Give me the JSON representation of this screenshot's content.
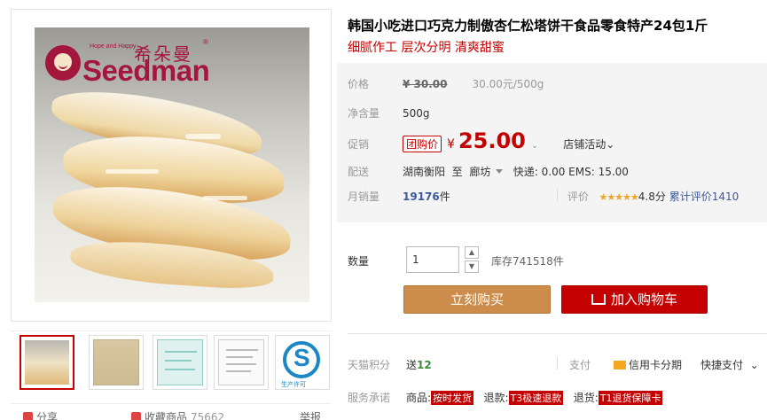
{
  "gallery": {
    "logo": {
      "brand_cn": "希朵曼",
      "brand_en": "Seedman",
      "tagline": "Hope and Happy",
      "reg": "®"
    },
    "thumbs": [
      {
        "name": "thumb-pastry",
        "active": true
      },
      {
        "name": "thumb-package"
      },
      {
        "name": "thumb-certificate"
      },
      {
        "name": "thumb-document"
      },
      {
        "name": "thumb-qs",
        "caption": "生产许可"
      }
    ],
    "share_label": "分享",
    "favorite_label": "收藏商品",
    "favorite_count": "75662",
    "report_label": "举报"
  },
  "product": {
    "title": "韩国小吃进口巧克力制傲杏仁松塔饼干食品零食特产24包1斤",
    "subtitle": "细腻作工 层次分明 清爽甜蜜"
  },
  "price": {
    "label": "价格",
    "original": "¥ 30.00",
    "unit_price": "30.00元/500g"
  },
  "weight": {
    "label": "净含量",
    "value": "500g"
  },
  "promo": {
    "label": "促销",
    "tag": "团购价",
    "currency": "¥",
    "price": "25.00",
    "store_activity": "店铺活动"
  },
  "delivery": {
    "label": "配送",
    "from": "湖南衡阳",
    "to_word": "至",
    "to": "廊坊",
    "fee": "快递: 0.00 EMS: 15.00"
  },
  "sales": {
    "label": "月销量",
    "count": "19176",
    "unit": "件",
    "rating_label": "评价",
    "stars": "★★★★★",
    "score": "4.8分",
    "cumulative": "累计评价1410"
  },
  "quantity": {
    "label": "数量",
    "value": "1",
    "up": "▲",
    "down": "▼",
    "stock": "库存741518件"
  },
  "buttons": {
    "buy": "立刻购买",
    "cart": "加入购物车"
  },
  "points": {
    "label": "天猫积分",
    "prefix": "送",
    "value": "12"
  },
  "payment": {
    "label": "支付",
    "credit": "信用卡分期",
    "quick": "快捷支付"
  },
  "service": {
    "label": "服务承诺",
    "goods_label": "商品:",
    "goods_tag": "按时发货",
    "refund_label": "退款:",
    "refund_tag": "T3极速退款",
    "return_label": "退货:",
    "return_tag": "T1退货保障卡"
  },
  "colors": {
    "accent": "#c40000",
    "buy": "#cc8d4c",
    "brand": "#a3173d"
  }
}
